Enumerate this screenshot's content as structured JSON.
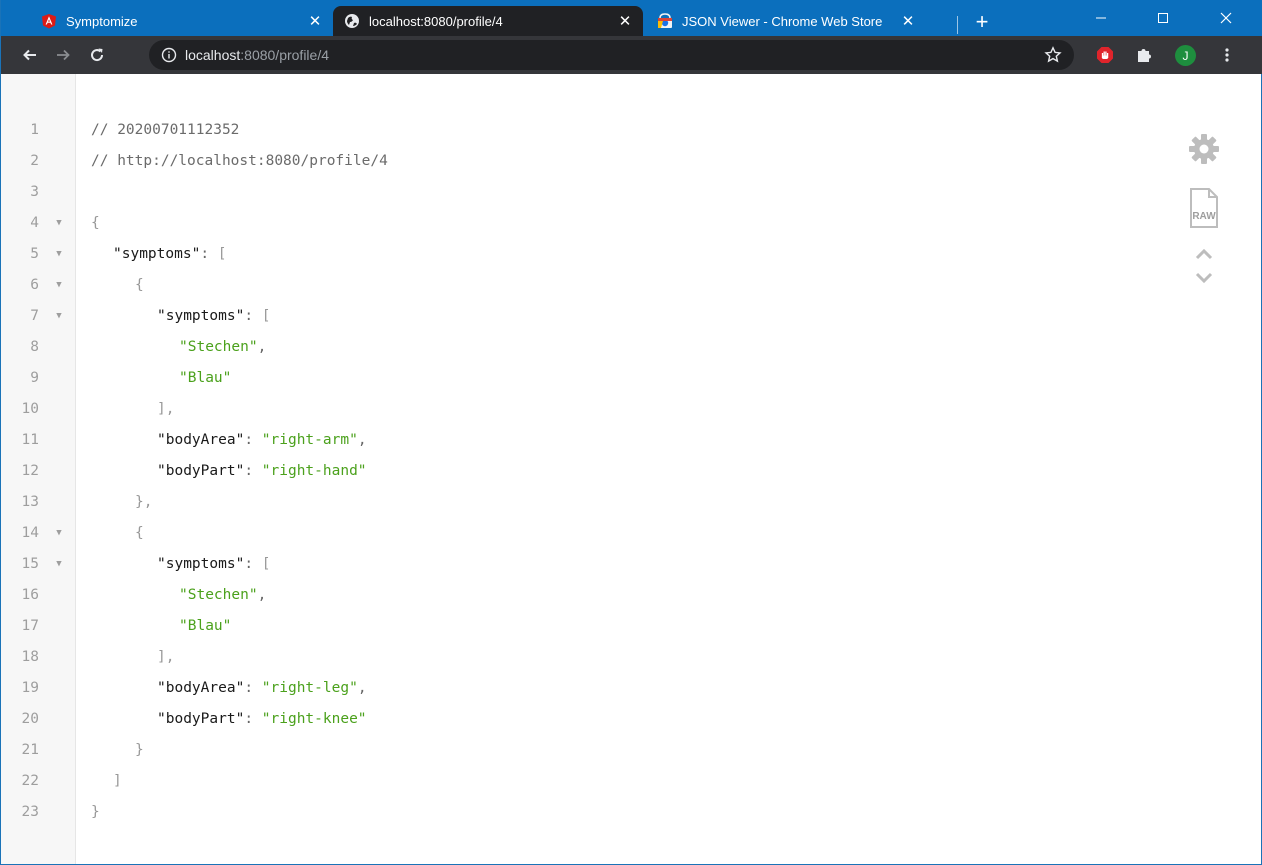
{
  "tabs": [
    {
      "title": "Symptomize",
      "favicon": "angular-icon",
      "active": false
    },
    {
      "title": "localhost:8080/profile/4",
      "favicon": "globe-icon",
      "active": true
    },
    {
      "title": "JSON Viewer - Chrome Web Store",
      "favicon": "chrome-web-store-icon",
      "active": false
    }
  ],
  "tab_close_glyph": "✕",
  "new_tab_glyph": "+",
  "window_controls": {
    "minimize": "—",
    "maximize": "☐",
    "close": "✕"
  },
  "toolbar": {
    "url_host": "localhost",
    "url_path": ":8080/profile/4",
    "avatar_letter": "J"
  },
  "json_lines": [
    {
      "n": "1"
    },
    {
      "n": "2"
    },
    {
      "n": "3"
    },
    {
      "n": "4"
    },
    {
      "n": "5"
    },
    {
      "n": "6"
    },
    {
      "n": "7"
    },
    {
      "n": "8"
    },
    {
      "n": "9"
    },
    {
      "n": "10"
    },
    {
      "n": "11"
    },
    {
      "n": "12"
    },
    {
      "n": "13"
    },
    {
      "n": "14"
    },
    {
      "n": "15"
    },
    {
      "n": "16"
    },
    {
      "n": "17"
    },
    {
      "n": "18"
    },
    {
      "n": "19"
    },
    {
      "n": "20"
    },
    {
      "n": "21"
    },
    {
      "n": "22"
    },
    {
      "n": "23"
    }
  ],
  "code": {
    "l1": "// 20200701112352",
    "l2": "// http://localhost:8080/profile/4",
    "brace_open": "{",
    "brace_close": "}",
    "brace_close_comma": "},",
    "bracket_open": "[",
    "bracket_close": "]",
    "bracket_close_comma": "],",
    "colon": ": ",
    "comma": ",",
    "key_symptoms": "\"symptoms\"",
    "key_bodyArea": "\"bodyArea\"",
    "key_bodyPart": "\"bodyPart\"",
    "entries": [
      {
        "s1": "\"Stechen\"",
        "s2": "\"Blau\"",
        "area": "\"right-arm\"",
        "part": "\"right-hand\""
      },
      {
        "s1": "\"Stechen\"",
        "s2": "\"Blau\"",
        "area": "\"right-leg\"",
        "part": "\"right-knee\""
      }
    ]
  },
  "side_tools": {
    "raw_label": "RAW"
  },
  "colors": {
    "titlebar": "#0b6fbd",
    "toolbar": "#35363a",
    "string": "#4ba11c",
    "avatar": "#1e8e3e"
  }
}
